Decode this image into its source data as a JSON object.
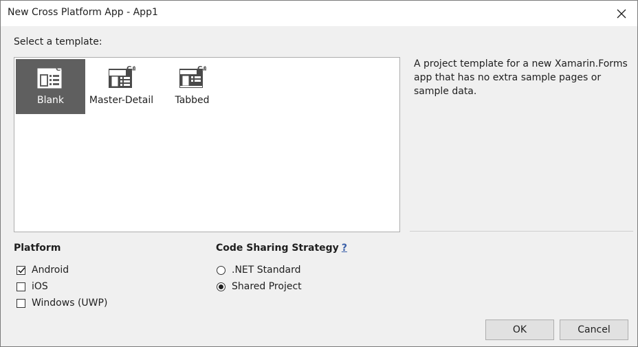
{
  "window": {
    "title": "New Cross Platform App - App1",
    "close_icon": "close-icon"
  },
  "templates": {
    "label": "Select a template:",
    "items": [
      {
        "label": "Blank",
        "icon": "blank-template-icon",
        "selected": true
      },
      {
        "label": "Master-Detail",
        "icon": "master-detail-template-icon",
        "selected": false
      },
      {
        "label": "Tabbed",
        "icon": "tabbed-template-icon",
        "selected": false
      }
    ],
    "icon_badge": "C#",
    "description": "A project template for a new Xamarin.Forms app that has no extra sample pages or sample data."
  },
  "platform": {
    "heading": "Platform",
    "options": [
      {
        "label": "Android",
        "checked": true
      },
      {
        "label": "iOS",
        "checked": false
      },
      {
        "label": "Windows (UWP)",
        "checked": false
      }
    ]
  },
  "strategy": {
    "heading": "Code Sharing Strategy",
    "help": "?",
    "options": [
      {
        "label": ".NET Standard",
        "selected": false
      },
      {
        "label": "Shared Project",
        "selected": true
      }
    ]
  },
  "buttons": {
    "ok": "OK",
    "cancel": "Cancel"
  },
  "colors": {
    "selection": "#5f5f5f",
    "dialog_bg": "#f0f0f0",
    "link": "#3a5fa8"
  }
}
